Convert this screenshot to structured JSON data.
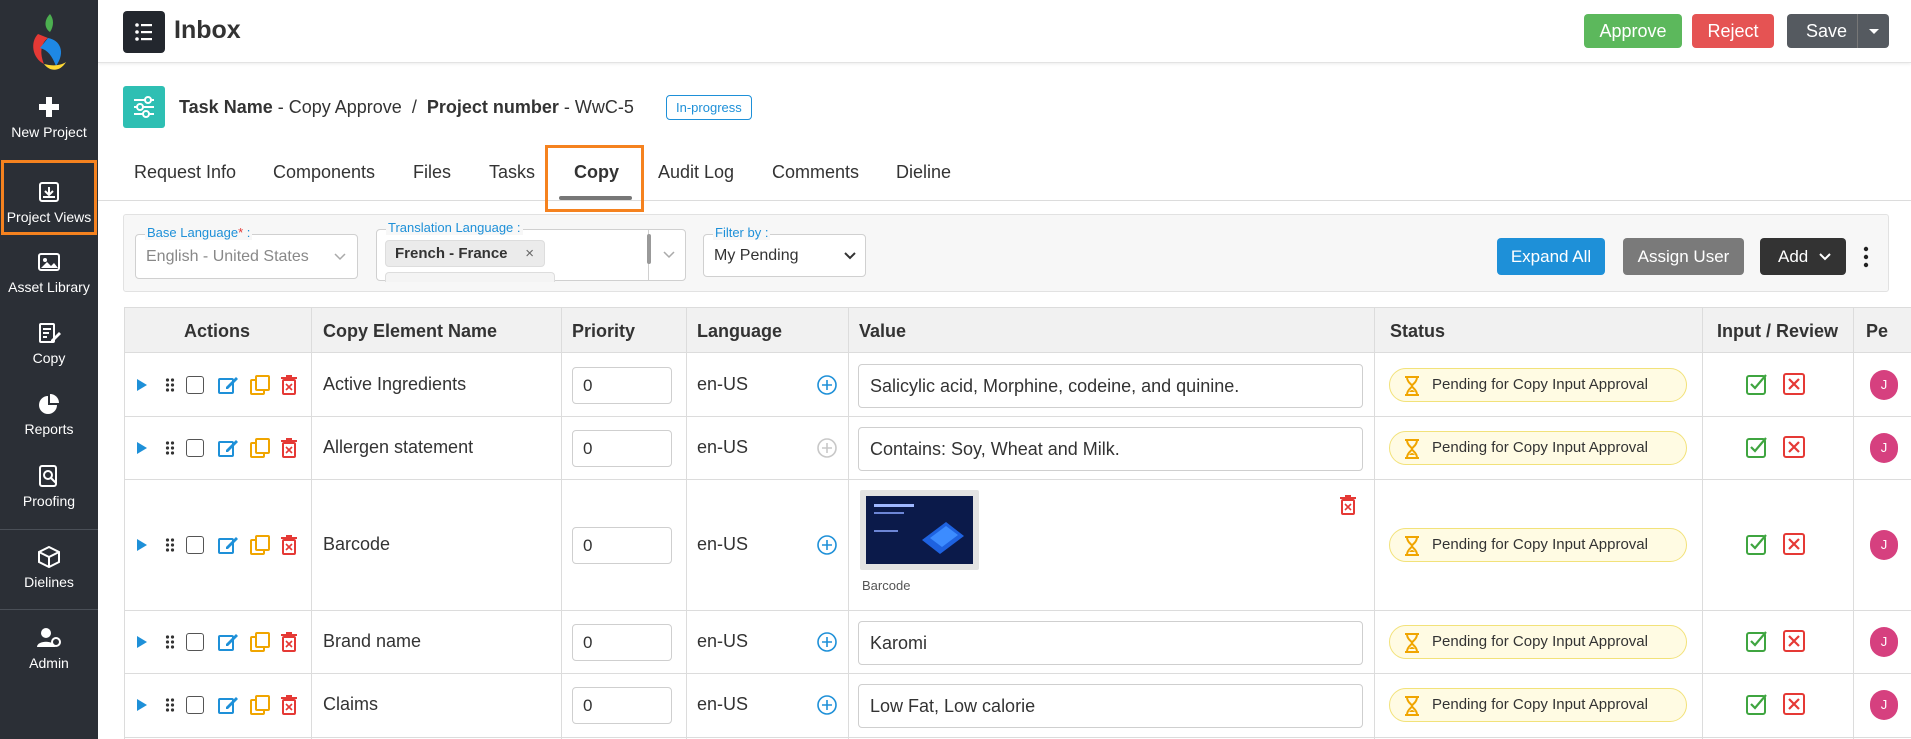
{
  "sidebar": {
    "items": [
      {
        "label": "New Project",
        "icon": "plus-icon"
      },
      {
        "label": "Project Views",
        "icon": "project-views-icon"
      },
      {
        "label": "Asset Library",
        "icon": "image-icon"
      },
      {
        "label": "Copy",
        "icon": "copy-edit-icon"
      },
      {
        "label": "Reports",
        "icon": "pie-chart-icon"
      },
      {
        "label": "Proofing",
        "icon": "proofing-icon"
      },
      {
        "label": "Dielines",
        "icon": "box-icon"
      },
      {
        "label": "Admin",
        "icon": "admin-icon"
      }
    ]
  },
  "header": {
    "title": "Inbox",
    "approve_label": "Approve",
    "reject_label": "Reject",
    "save_label": "Save"
  },
  "task": {
    "task_name_label": "Task Name",
    "task_name_value": "Copy Approve",
    "separator": "/",
    "project_number_label": "Project number",
    "project_number_value": "WwC-5",
    "status_badge": "In-progress"
  },
  "tabs": [
    "Request Info",
    "Components",
    "Files",
    "Tasks",
    "Copy",
    "Audit Log",
    "Comments",
    "Dieline"
  ],
  "filters": {
    "base_language_label": "Base Language",
    "base_language_value": "English - United States",
    "translation_language_label": "Translation Language :",
    "translation_language_chip": "French - France",
    "filter_by_label": "Filter by :",
    "filter_by_value": "My Pending",
    "expand_all_label": "Expand All",
    "assign_user_label": "Assign User",
    "add_label": "Add"
  },
  "table": {
    "headers": [
      "Actions",
      "Copy Element Name",
      "Priority",
      "Language",
      "Value",
      "Status",
      "Input / Review",
      "Pe"
    ],
    "rows": [
      {
        "name": "Active Ingredients",
        "priority": "0",
        "language": "en-US",
        "value": "Salicylic acid, Morphine, codeine, and quinine.",
        "status": "Pending for Copy Input Approval",
        "user": "J"
      },
      {
        "name": "Allergen statement",
        "priority": "0",
        "language": "en-US",
        "value": "Contains: Soy, Wheat and Milk.",
        "status": "Pending for Copy Input Approval",
        "user": "J"
      },
      {
        "name": "Barcode",
        "priority": "0",
        "language": "en-US",
        "value": "Barcode",
        "status": "Pending for Copy Input Approval",
        "user": "J"
      },
      {
        "name": "Brand name",
        "priority": "0",
        "language": "en-US",
        "value": "Karomi",
        "status": "Pending for Copy Input Approval",
        "user": "J"
      },
      {
        "name": "Claims",
        "priority": "0",
        "language": "en-US",
        "value": "Low Fat, Low calorie",
        "status": "Pending for Copy Input Approval",
        "user": "J"
      }
    ]
  },
  "colors": {
    "sidebar_bg": "#2b2f36",
    "accent_orange": "#f5821f",
    "approve": "#5cb85c",
    "reject": "#e55353",
    "primary_blue": "#1e90d8"
  }
}
